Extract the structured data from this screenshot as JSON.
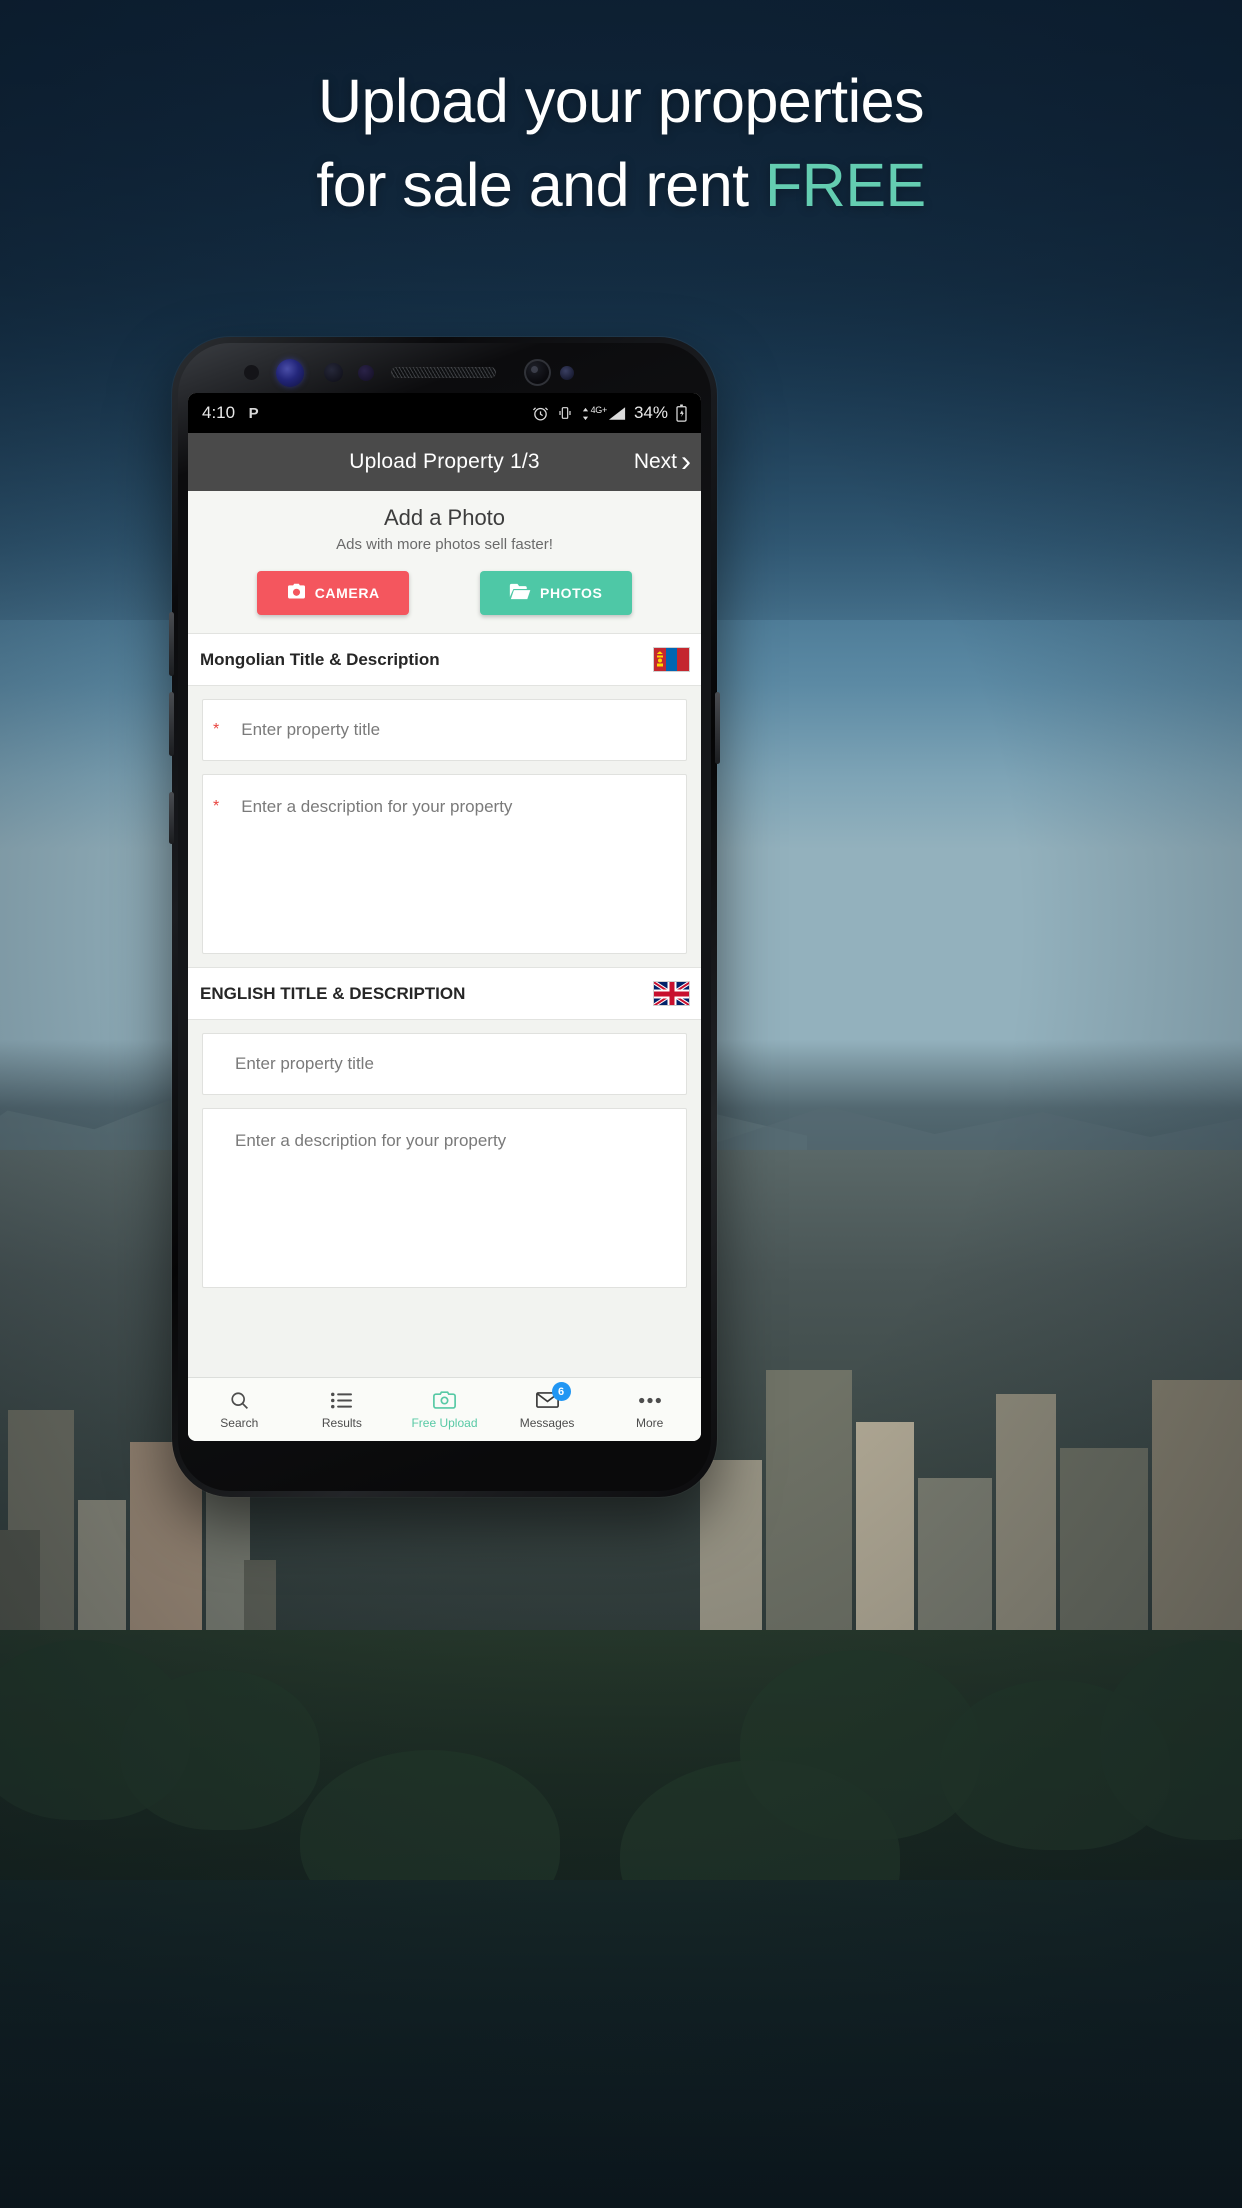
{
  "promo": {
    "line1": "Upload your properties",
    "line2_pre": "for sale and rent ",
    "line2_accent": "FREE",
    "accent_color": "#64cdb1"
  },
  "statusbar": {
    "time": "4:10",
    "p_icon": "P",
    "alarm_icon": "alarm-clock-icon",
    "vibrate_icon": "vibrate-icon",
    "network_label": "4G+",
    "battery_percent": "34%",
    "battery_icon": "battery-charging-icon"
  },
  "toolbar": {
    "title": "Upload Property 1/3",
    "next_label": "Next",
    "next_chevron": "›"
  },
  "photo_section": {
    "title": "Add a Photo",
    "subtitle": "Ads with more photos sell faster!",
    "camera_button": "CAMERA",
    "photos_button": "PHOTOS",
    "camera_color": "#f4565e",
    "photos_color": "#4ec8a6"
  },
  "mongolian_section": {
    "header": "Mongolian Title & Description",
    "flag": "mongolia-flag",
    "title_placeholder": "Enter property title",
    "title_value": "",
    "description_placeholder": "Enter a description for your property",
    "description_value": "",
    "required_marker": "*"
  },
  "english_section": {
    "header": "ENGLISH TITLE & DESCRIPTION",
    "flag": "united-kingdom-flag",
    "title_placeholder": "Enter property title",
    "title_value": "",
    "description_placeholder": "Enter a description for your property",
    "description_value": ""
  },
  "bottom_nav": {
    "items": [
      {
        "label": "Search",
        "icon": "search-icon",
        "active": false,
        "badge": ""
      },
      {
        "label": "Results",
        "icon": "list-icon",
        "active": false,
        "badge": ""
      },
      {
        "label": "Free Upload",
        "icon": "camera-icon",
        "active": true,
        "badge": ""
      },
      {
        "label": "Messages",
        "icon": "envelope-icon",
        "active": false,
        "badge": "6"
      },
      {
        "label": "More",
        "icon": "ellipsis-icon",
        "active": false,
        "badge": ""
      }
    ],
    "active_color": "#57c9a5",
    "badge_color": "#2196f3"
  }
}
